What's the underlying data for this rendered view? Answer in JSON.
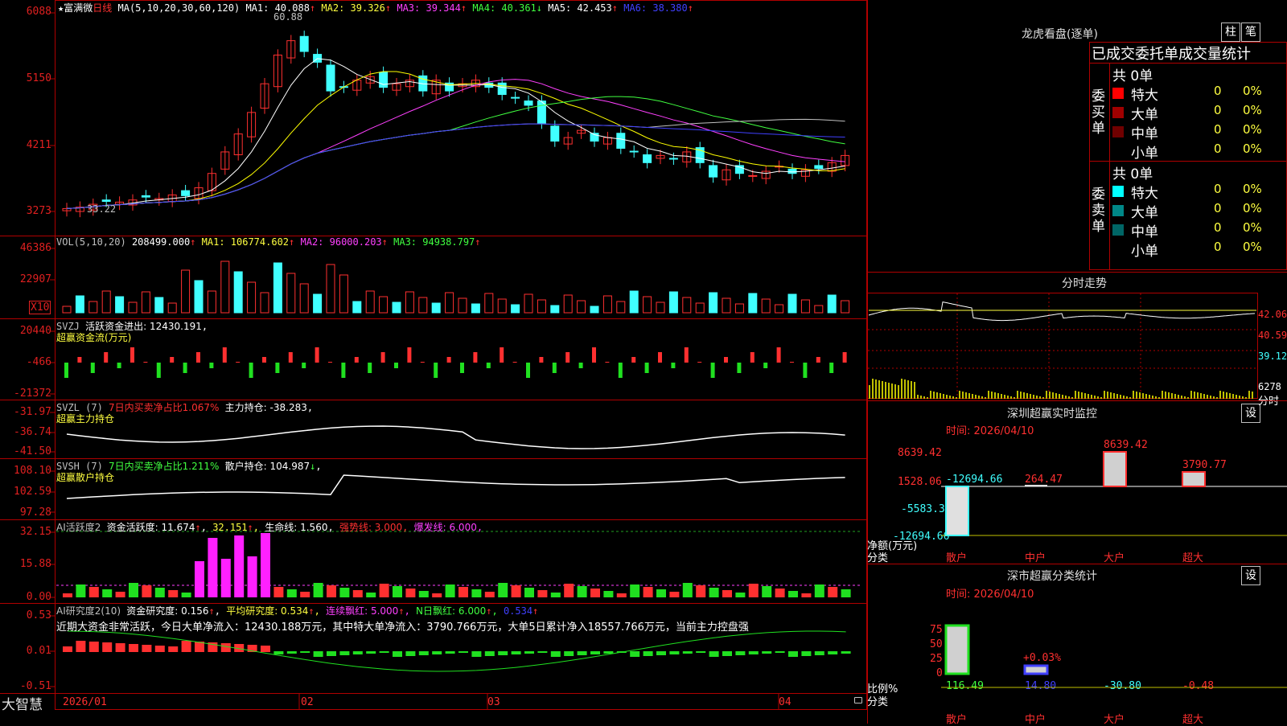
{
  "title_bar": {
    "star": "★",
    "stock_name": "富满微",
    "period": "日线",
    "ma_params": "MA(5,10,20,30,60,120)",
    "ma1": "MA1: 40.088",
    "ma1_arrow": "↑",
    "ma2": "MA2: 39.326",
    "ma2_arrow": "↑",
    "ma3": "MA3: 39.344",
    "ma3_arrow": "↑",
    "ma4": "MA4: 40.361",
    "ma4_arrow": "↓",
    "ma5": "MA5: 42.453",
    "ma5_arrow": "↑",
    "ma6": "MA6: 38.380",
    "ma6_arrow": "↑"
  },
  "price_axis": [
    "6088",
    "5150",
    "4211",
    "3273"
  ],
  "price_high_mark": "60.88",
  "price_low_mark": "33.22",
  "vol_header": {
    "name": "VOL(5,10,20)",
    "value": "208499.000",
    "ma1": "MA1: 106774.602",
    "ma2": "MA2: 96000.203",
    "ma3": "MA3: 94938.797",
    "arrow": "↑"
  },
  "vol_axis": [
    "46386",
    "22907"
  ],
  "vol_unit": "X10",
  "svzj": {
    "name": "SVZJ",
    "label": "活跃资金进出: 12430.191",
    "sub": "超赢资金流(万元)",
    "axis": [
      "20440",
      "-466",
      "-21372"
    ]
  },
  "svzl": {
    "name": "SVZL (7)",
    "label_red": "7日内买卖净占比1.067%",
    "label2": "主力持仓: -38.283",
    "sub": "超赢主力持仓",
    "axis": [
      "-31.97",
      "-36.74",
      "-41.50"
    ]
  },
  "svsh": {
    "name": "SVSH (7)",
    "label_grn": "7日内买卖净占比1.211%",
    "label2": "散户持仓: 104.987",
    "sub": "超赢散户持仓",
    "axis": [
      "108.10",
      "102.59",
      "97.28"
    ]
  },
  "ai2": {
    "name": "AI活跃度2",
    "a": "资金活跃度: 11.674",
    "b": "32.151",
    "c": "生命线: 1.560",
    "d": "强势线: 3.000",
    "e": "爆发线: 6.000",
    "axis": [
      "32.15",
      "15.88",
      "0.00"
    ]
  },
  "ai_research": {
    "name": "AI研究度2(10)",
    "a": "资金研究度: 0.156",
    "b": "平均研究度: 0.534",
    "c": "连续飘红: 5.000",
    "d": "N日飘红: 6.000",
    "e": "0.534",
    "text": "近期大资金非常活跃，今日大单净流入：12430.188万元，其中特大单净流入：3790.766万元，大单5日累计净入18557.766万元，当前主力控盘强",
    "axis": [
      "0.53",
      "0.01",
      "-0.51"
    ]
  },
  "x_axis": [
    "2026/01",
    "02",
    "03",
    "04"
  ],
  "brand": "大智慧",
  "dragon": {
    "title": "龙虎看盘(逐单)",
    "btn1": "柱",
    "btn2": "笔",
    "subtitle": "已成交委托单成交量统计",
    "buy_label": "委买单",
    "sell_label": "委卖单",
    "buy_total": "共 0单",
    "sell_total": "共 0单",
    "buy_rows": [
      {
        "name": "特大",
        "n": "0",
        "p": "0%",
        "color": "#ff0000"
      },
      {
        "name": "大单",
        "n": "0",
        "p": "0%",
        "color": "#a00000"
      },
      {
        "name": "中单",
        "n": "0",
        "p": "0%",
        "color": "#700000"
      },
      {
        "name": "小单",
        "n": "0",
        "p": "0%",
        "color": "#000000"
      }
    ],
    "sell_rows": [
      {
        "name": "特大",
        "n": "0",
        "p": "0%",
        "color": "#00ffff"
      },
      {
        "name": "大单",
        "n": "0",
        "p": "0%",
        "color": "#008888"
      },
      {
        "name": "中单",
        "n": "0",
        "p": "0%",
        "color": "#006666"
      },
      {
        "name": "小单",
        "n": "0",
        "p": "0%",
        "color": "#000000"
      }
    ]
  },
  "intraday": {
    "title": "分时走势",
    "axis": [
      "42.06",
      "40.59",
      "39.12"
    ],
    "vol_axis": [
      "6278",
      "分时"
    ]
  },
  "sz_monitor": {
    "title": "深圳超赢实时监控",
    "btn": "设",
    "time": "时间: 2026/04/10",
    "axis": [
      "8639.42",
      "1528.06",
      "-5583.3",
      "-12694.66"
    ],
    "bar_labels": [
      "-12694.66",
      "264.47",
      "8639.42",
      "3790.77"
    ],
    "unit": "净额(万元)",
    "cat_label": "分类",
    "categories": [
      "散户",
      "中户",
      "大户",
      "超大"
    ]
  },
  "sz_class": {
    "title": "深市超赢分类统计",
    "btn": "设",
    "time": "时间: 2026/04/10",
    "axis": [
      "75",
      "50",
      "25",
      "0"
    ],
    "bar_label": "+0.03%",
    "unit": "比例%",
    "cat_label": "分类",
    "values": [
      "116.49",
      "14.80",
      "-30.80",
      "-0.48"
    ],
    "categories": [
      "散户",
      "中户",
      "大户",
      "超大"
    ]
  },
  "colors": {
    "up": "#ff3030",
    "down": "#40ffff",
    "border": "#b00000",
    "ma1": "#ffffff",
    "ma2": "#ffff00",
    "ma3": "#ff40ff",
    "ma4": "#40ff40",
    "ma5": "#c0c0c0",
    "ma6": "#4040ff"
  }
}
